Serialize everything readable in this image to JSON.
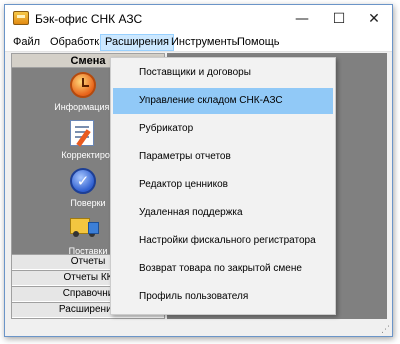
{
  "window": {
    "title": "Бэк-офис СНК АЗС",
    "controls": {
      "minimize": "—",
      "maximize": "☐",
      "close": "✕"
    }
  },
  "menubar": {
    "items": [
      "Файл",
      "Обработка",
      "Расширения",
      "Инструменты",
      "Помощь"
    ],
    "active_index": 2
  },
  "left_panel": {
    "header": "Смена",
    "entries": [
      {
        "label": "Информация по",
        "icon": "clock-icon"
      },
      {
        "label": "Корректиров",
        "icon": "pencil-edit-icon"
      },
      {
        "label": "Поверки",
        "icon": "checkmark-icon"
      },
      {
        "label": "Поставки",
        "icon": "truck-icon"
      }
    ],
    "sections": [
      "Отчеты",
      "Отчеты КК",
      "Справочни",
      "Расширения"
    ]
  },
  "dropdown": {
    "items": [
      "Поставщики и договоры",
      "Управление складом СНК-АЗС",
      "Рубрикатор",
      "Параметры отчетов",
      "Редактор ценников",
      "Удаленная поддержка",
      "Настройки фискального регистратора",
      "Возврат товара по закрытой смене",
      "Профиль пользователя"
    ],
    "highlighted_index": 1
  },
  "colors": {
    "menu_active_bg": "#cce8ff",
    "dropdown_highlight": "#91c9f7",
    "workspace_gray": "#808080"
  }
}
